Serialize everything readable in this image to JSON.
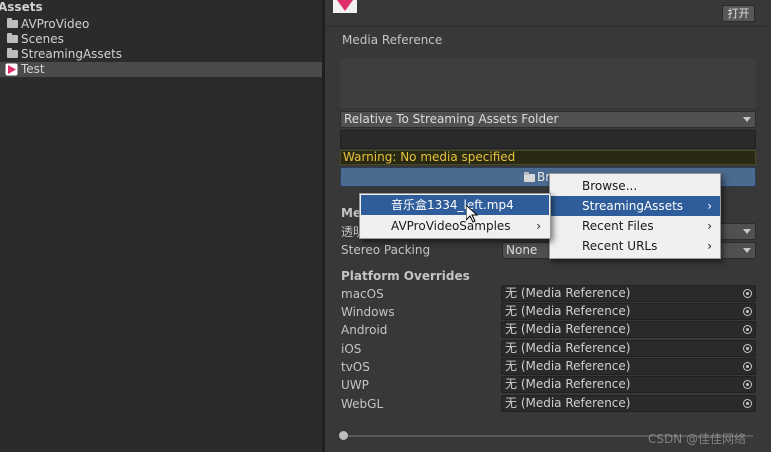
{
  "project": {
    "header": "Assets",
    "items": [
      {
        "label": "AVProVideo",
        "icon": "folder-icon"
      },
      {
        "label": "Scenes",
        "icon": "folder-icon"
      },
      {
        "label": "StreamingAssets",
        "icon": "folder-icon"
      },
      {
        "label": "Test",
        "icon": "avpro-media-icon",
        "selected": true
      }
    ]
  },
  "inspector": {
    "open_button": "打开",
    "media_reference_label": "Media Reference",
    "path_mode": "Relative To Streaming Assets Folder",
    "path_value": "",
    "warning": "Warning: No media specified",
    "browse_button": "Br",
    "section_me": "Me",
    "row_transparency_label": "透明",
    "stereo_packing_label": "Stereo Packing",
    "stereo_packing_value": "None",
    "platform_overrides_label": "Platform Overrides",
    "platforms": [
      {
        "name": "macOS",
        "value": "无 (Media Reference)"
      },
      {
        "name": "Windows",
        "value": "无 (Media Reference)"
      },
      {
        "name": "Android",
        "value": "无 (Media Reference)"
      },
      {
        "name": "iOS",
        "value": "无 (Media Reference)"
      },
      {
        "name": "tvOS",
        "value": "无 (Media Reference)"
      },
      {
        "name": "UWP",
        "value": "无 (Media Reference)"
      },
      {
        "name": "WebGL",
        "value": "无 (Media Reference)"
      }
    ]
  },
  "browse_menu": {
    "items": [
      {
        "label": "Browse...",
        "has_submenu": false,
        "highlighted": false
      },
      {
        "label": "StreamingAssets",
        "has_submenu": true,
        "highlighted": true
      },
      {
        "label": "Recent Files",
        "has_submenu": true,
        "highlighted": false
      },
      {
        "label": "Recent URLs",
        "has_submenu": true,
        "highlighted": false
      }
    ]
  },
  "streaming_submenu": {
    "items": [
      {
        "label": "音乐盒1334_left.mp4",
        "has_submenu": false,
        "highlighted": true
      },
      {
        "label": "AVProVideoSamples",
        "has_submenu": true,
        "highlighted": false
      }
    ]
  },
  "watermark": "CSDN @佳佳网络",
  "colors": {
    "warning_text": "#e6c33a",
    "menu_highlight": "#2f5d9b",
    "browse_button": "#4b6a8f",
    "avpro_icon": "#e0306a"
  }
}
